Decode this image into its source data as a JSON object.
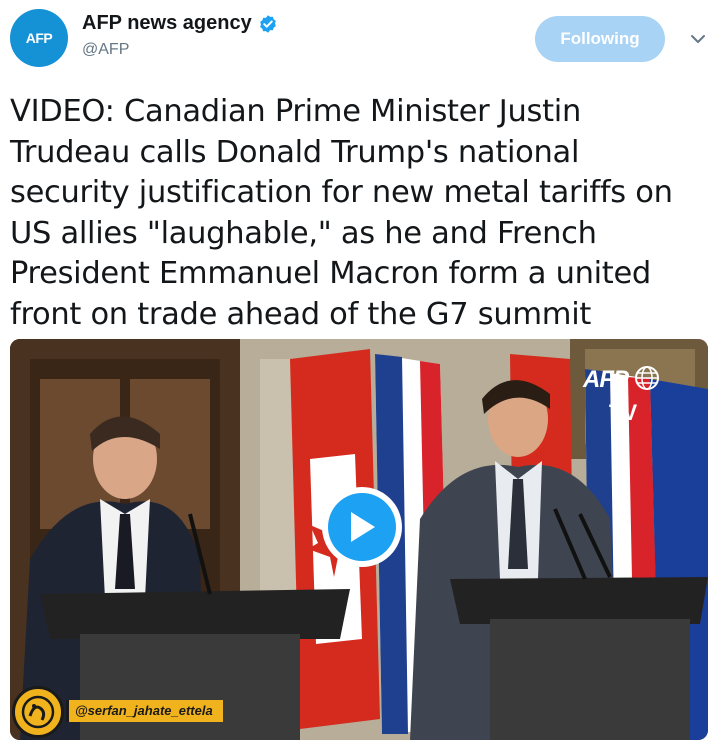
{
  "account": {
    "avatar_text": "AFP",
    "display_name": "AFP news agency",
    "handle": "@AFP",
    "verified": true
  },
  "follow_button": {
    "label": "Following"
  },
  "tweet": {
    "lines": [
      "VIDEO: Canadian Prime Minister Justin",
      "Trudeau calls Donald Trump's national",
      "security justification for new metal tariffs on",
      "US allies \"laughable,\" as he and French",
      "President Emmanuel Macron form a united",
      "front on trade ahead of the G7 summit"
    ]
  },
  "media": {
    "type": "video",
    "logo_text": "AFP",
    "logo_subtext": "TV",
    "watermark": "@serfan_jahate_ettela"
  },
  "colors": {
    "accent": "#1da1f2",
    "follow_bg": "#a8d3f4",
    "avatar_bg": "#1591d6",
    "watermark_bg": "#f0b31e"
  },
  "icons": [
    "verified-badge-icon",
    "chevron-down-icon",
    "play-icon",
    "afp-globe-icon"
  ]
}
